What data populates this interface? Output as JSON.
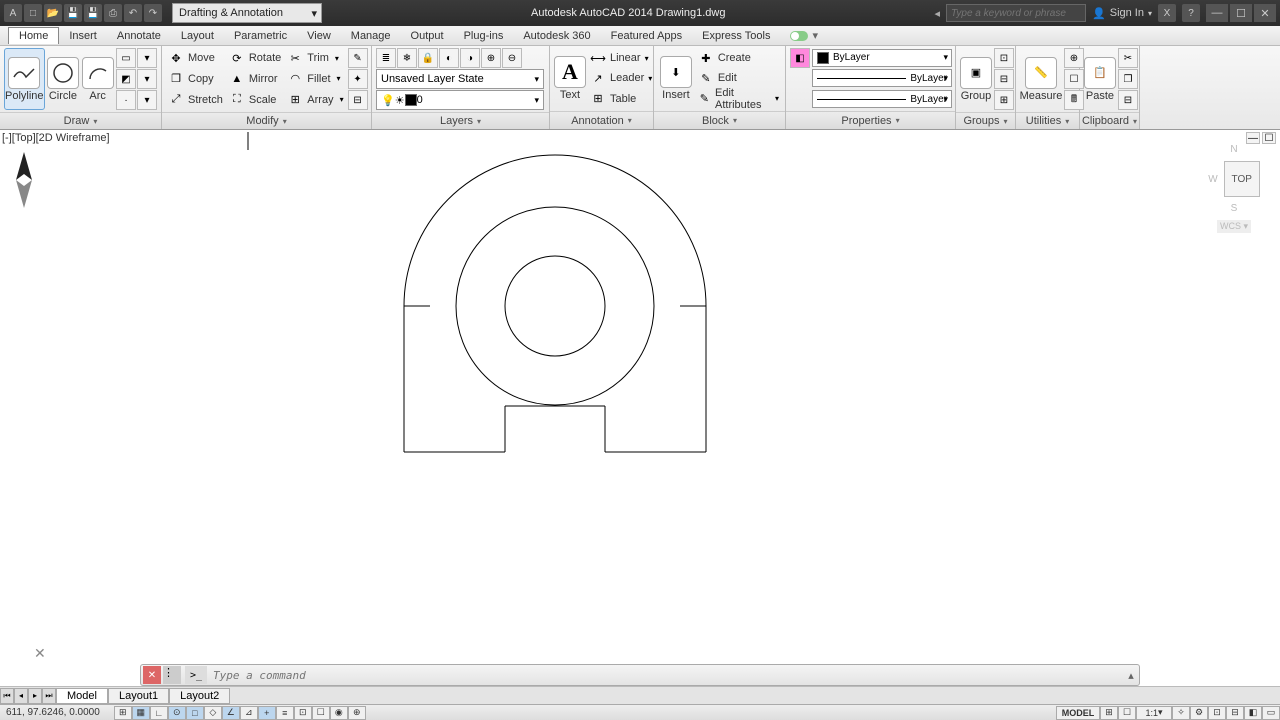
{
  "app": {
    "title": "Autodesk AutoCAD 2014   Drawing1.dwg",
    "workspace": "Drafting & Annotation",
    "search_placeholder": "Type a keyword or phrase",
    "signin": "Sign In"
  },
  "menus": [
    "Home",
    "Insert",
    "Annotate",
    "Layout",
    "Parametric",
    "View",
    "Manage",
    "Output",
    "Plug-ins",
    "Autodesk 360",
    "Featured Apps",
    "Express Tools"
  ],
  "draw": {
    "polyline": "Polyline",
    "circle": "Circle",
    "arc": "Arc",
    "panel": "Draw"
  },
  "modify": {
    "move": "Move",
    "rotate": "Rotate",
    "trim": "Trim",
    "copy": "Copy",
    "mirror": "Mirror",
    "fillet": "Fillet",
    "stretch": "Stretch",
    "scale": "Scale",
    "array": "Array",
    "panel": "Modify"
  },
  "layers": {
    "state": "Unsaved Layer State",
    "current": "0",
    "panel": "Layers"
  },
  "annotation": {
    "text": "Text",
    "linear": "Linear",
    "leader": "Leader",
    "table": "Table",
    "panel": "Annotation"
  },
  "block": {
    "insert": "Insert",
    "create": "Create",
    "edit": "Edit",
    "attrs": "Edit Attributes",
    "panel": "Block"
  },
  "properties": {
    "bylayer": "ByLayer",
    "panel": "Properties"
  },
  "groups": {
    "group": "Group",
    "panel": "Groups"
  },
  "utilities": {
    "measure": "Measure",
    "panel": "Utilities"
  },
  "clipboard": {
    "paste": "Paste",
    "panel": "Clipboard"
  },
  "viewport": {
    "label": "[-][Top][2D Wireframe]",
    "cube": "TOP",
    "n": "N",
    "w": "W",
    "s": "S",
    "wcs": "WCS ▾"
  },
  "cmd": {
    "placeholder": "Type a command",
    "prompt": ">_"
  },
  "tabs": {
    "model": "Model",
    "l1": "Layout1",
    "l2": "Layout2"
  },
  "status": {
    "coords": "611,  97.6246,  0.0000",
    "model": "MODEL",
    "scale": "1:1"
  }
}
